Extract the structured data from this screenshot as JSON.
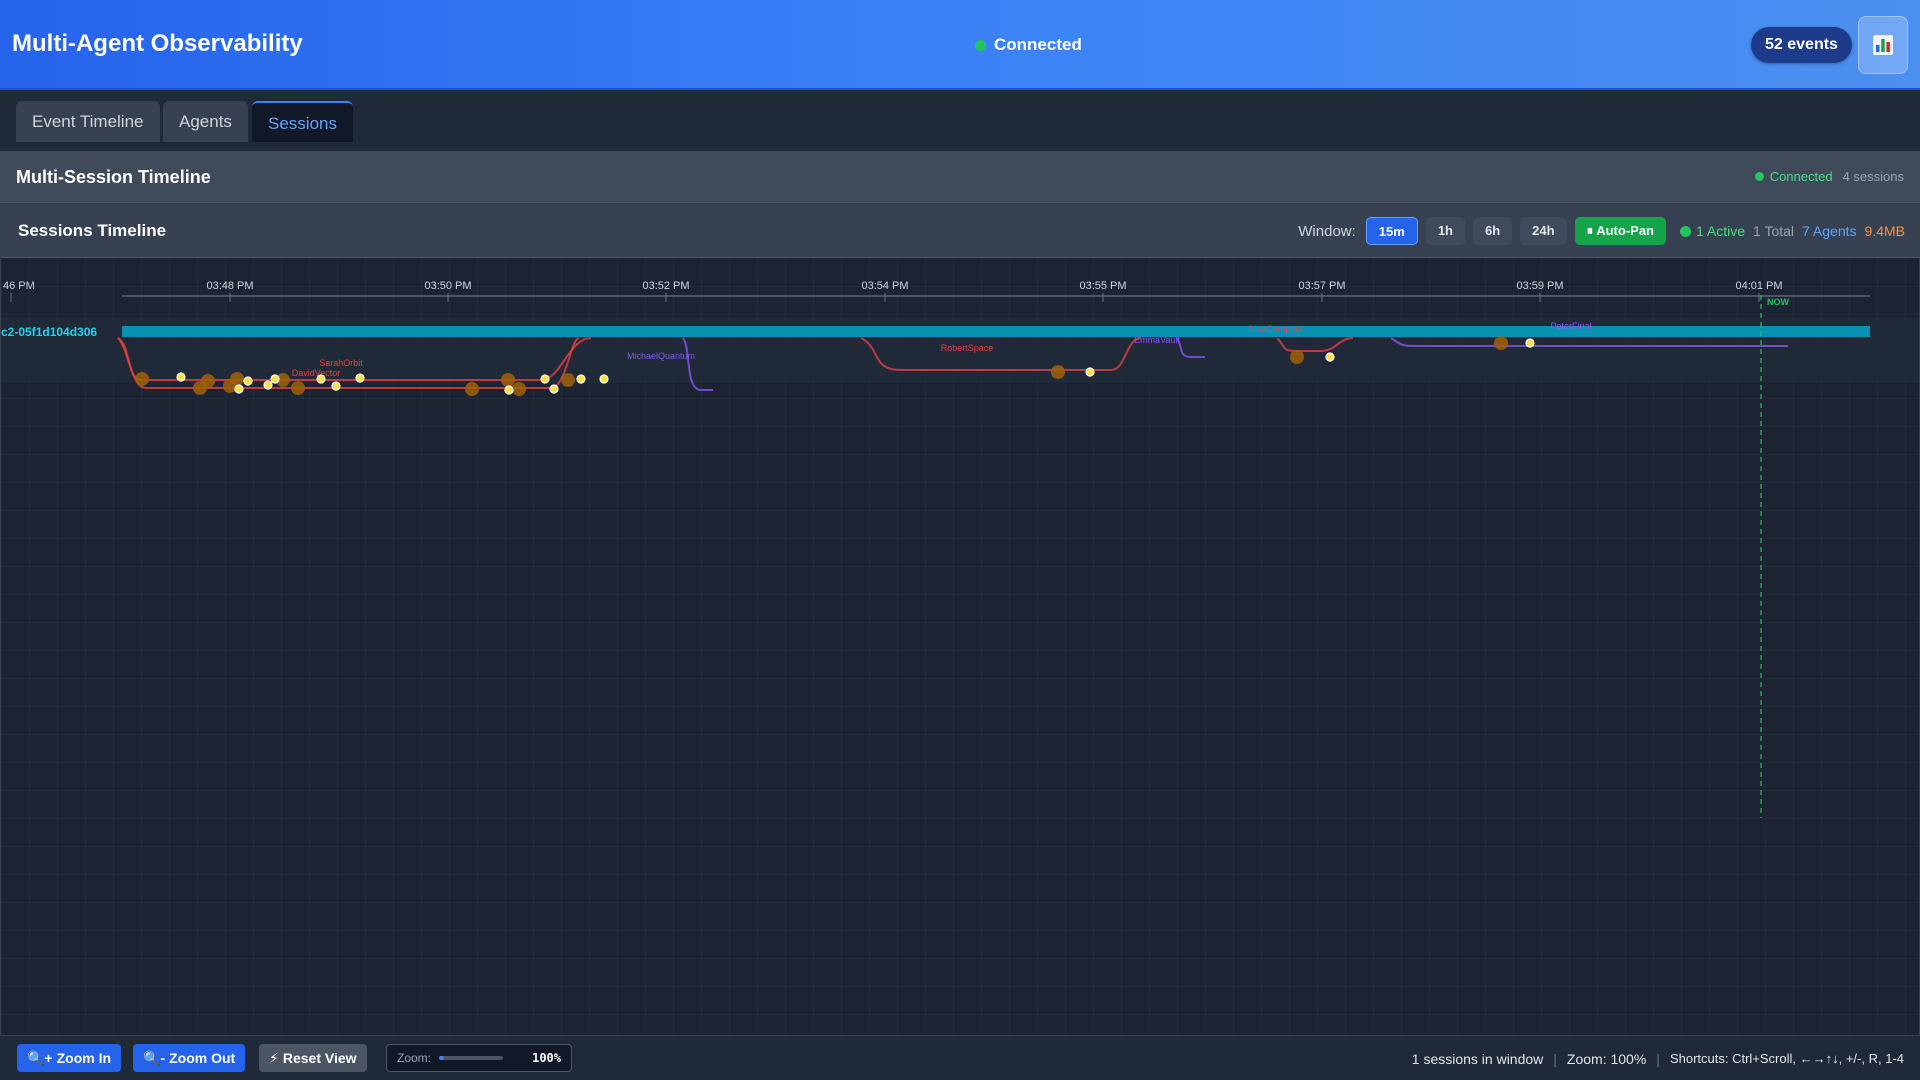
{
  "header": {
    "title": "Multi-Agent Observability",
    "connection": "Connected",
    "events_badge": "52 events"
  },
  "tabs": [
    {
      "label": "Event Timeline",
      "active": false
    },
    {
      "label": "Agents",
      "active": false
    },
    {
      "label": "Sessions",
      "active": true
    }
  ],
  "section": {
    "title": "Multi-Session Timeline",
    "status": "Connected",
    "sessions": "4 sessions"
  },
  "panel": {
    "title": "Sessions Timeline",
    "window_label": "Window:",
    "windows": [
      "15m",
      "1h",
      "6h",
      "24h"
    ],
    "active_window": "15m",
    "autopan_label": "Auto-Pan",
    "active_stat": "1 Active",
    "total_stat": "1 Total",
    "agents_stat": "7 Agents",
    "memory_stat": "9.4MB"
  },
  "timeline": {
    "ticks": [
      "46 PM",
      "03:48 PM",
      "03:50 PM",
      "03:52 PM",
      "03:54 PM",
      "03:55 PM",
      "03:57 PM",
      "03:59 PM",
      "04:01 PM"
    ],
    "now_label": "NOW",
    "session_label": "c2-05f1d104d306",
    "agents": [
      {
        "name": "SarahOrbit",
        "color": "#ef4444"
      },
      {
        "name": "DavidVector",
        "color": "#ef4444"
      },
      {
        "name": "MichaelQuantum",
        "color": "#8b5cf6"
      },
      {
        "name": "RobertSpace",
        "color": "#ef4444"
      },
      {
        "name": "EmmaVault",
        "color": "#8b5cf6"
      },
      {
        "name": "LisaCompact",
        "color": "#ef4444"
      },
      {
        "name": "PeterFinal",
        "color": "#8b5cf6"
      }
    ],
    "colors": {
      "session_bar": "#0891b2",
      "now_line": "#22c55e",
      "event_dot": "#fde047",
      "event_halo": "#a16207"
    }
  },
  "footer": {
    "zoom_in": "Zoom In",
    "zoom_out": "Zoom Out",
    "reset": "Reset View",
    "zoom_label": "Zoom:",
    "zoom_value": "100%",
    "zoom_fraction": 0.0,
    "sessions_in_window": "1 sessions in window",
    "zoom_stat": "Zoom: 100%",
    "shortcuts": "Shortcuts: Ctrl+Scroll, ←→↑↓, +/-, R, 1-4"
  }
}
